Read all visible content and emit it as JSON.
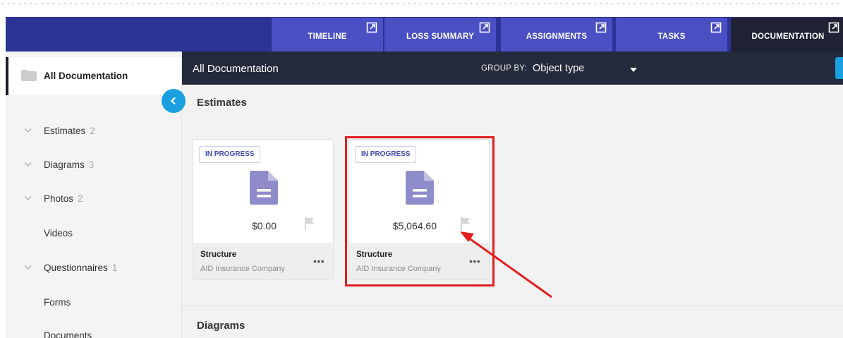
{
  "tabs": [
    {
      "label": "TIMELINE",
      "active": false
    },
    {
      "label": "LOSS SUMMARY",
      "active": false
    },
    {
      "label": "ASSIGNMENTS",
      "active": false
    },
    {
      "label": "TASKS",
      "active": false
    },
    {
      "label": "DOCUMENTATION",
      "active": true
    }
  ],
  "sidebar": {
    "header": "All Documentation",
    "items": [
      {
        "label": "Estimates",
        "count": "2",
        "expandable": true
      },
      {
        "label": "Diagrams",
        "count": "3",
        "expandable": true
      },
      {
        "label": "Photos",
        "count": "2",
        "expandable": true
      },
      {
        "label": "Videos",
        "count": "",
        "expandable": false
      },
      {
        "label": "Questionnaires",
        "count": "1",
        "expandable": true
      },
      {
        "label": "Forms",
        "count": "",
        "expandable": false
      },
      {
        "label": "Documents",
        "count": "",
        "expandable": false
      }
    ]
  },
  "main": {
    "title": "All Documentation",
    "group_by_label": "GROUP BY:",
    "group_by_value": "Object type",
    "sections": [
      {
        "title": "Estimates",
        "cards": [
          {
            "status": "IN PROGRESS",
            "amount": "$0.00",
            "name": "Structure",
            "company": "AID Insurance Company",
            "highlighted": false
          },
          {
            "status": "IN PROGRESS",
            "amount": "$5,064.60",
            "name": "Structure",
            "company": "AID Insurance Company",
            "highlighted": true
          }
        ]
      },
      {
        "title": "Diagrams"
      }
    ]
  },
  "colors": {
    "topbar": "#2b3395",
    "tab": "#4a50c4",
    "tab_active": "#1e2233",
    "header": "#232a3b",
    "accent": "#1a9fe0",
    "badge_text": "#3f4bb0",
    "doc_icon": "#8f8ccc",
    "highlight": "#e41e1e"
  },
  "icons": {
    "tab_external": "external-link-icon",
    "folder": "folder-icon",
    "chevron": "chevron-down-icon",
    "collapse": "chevron-left-icon",
    "caret": "caret-down-icon",
    "document": "document-icon",
    "flag": "flag-icon",
    "more": "more-icon"
  },
  "more_glyph": "•••"
}
